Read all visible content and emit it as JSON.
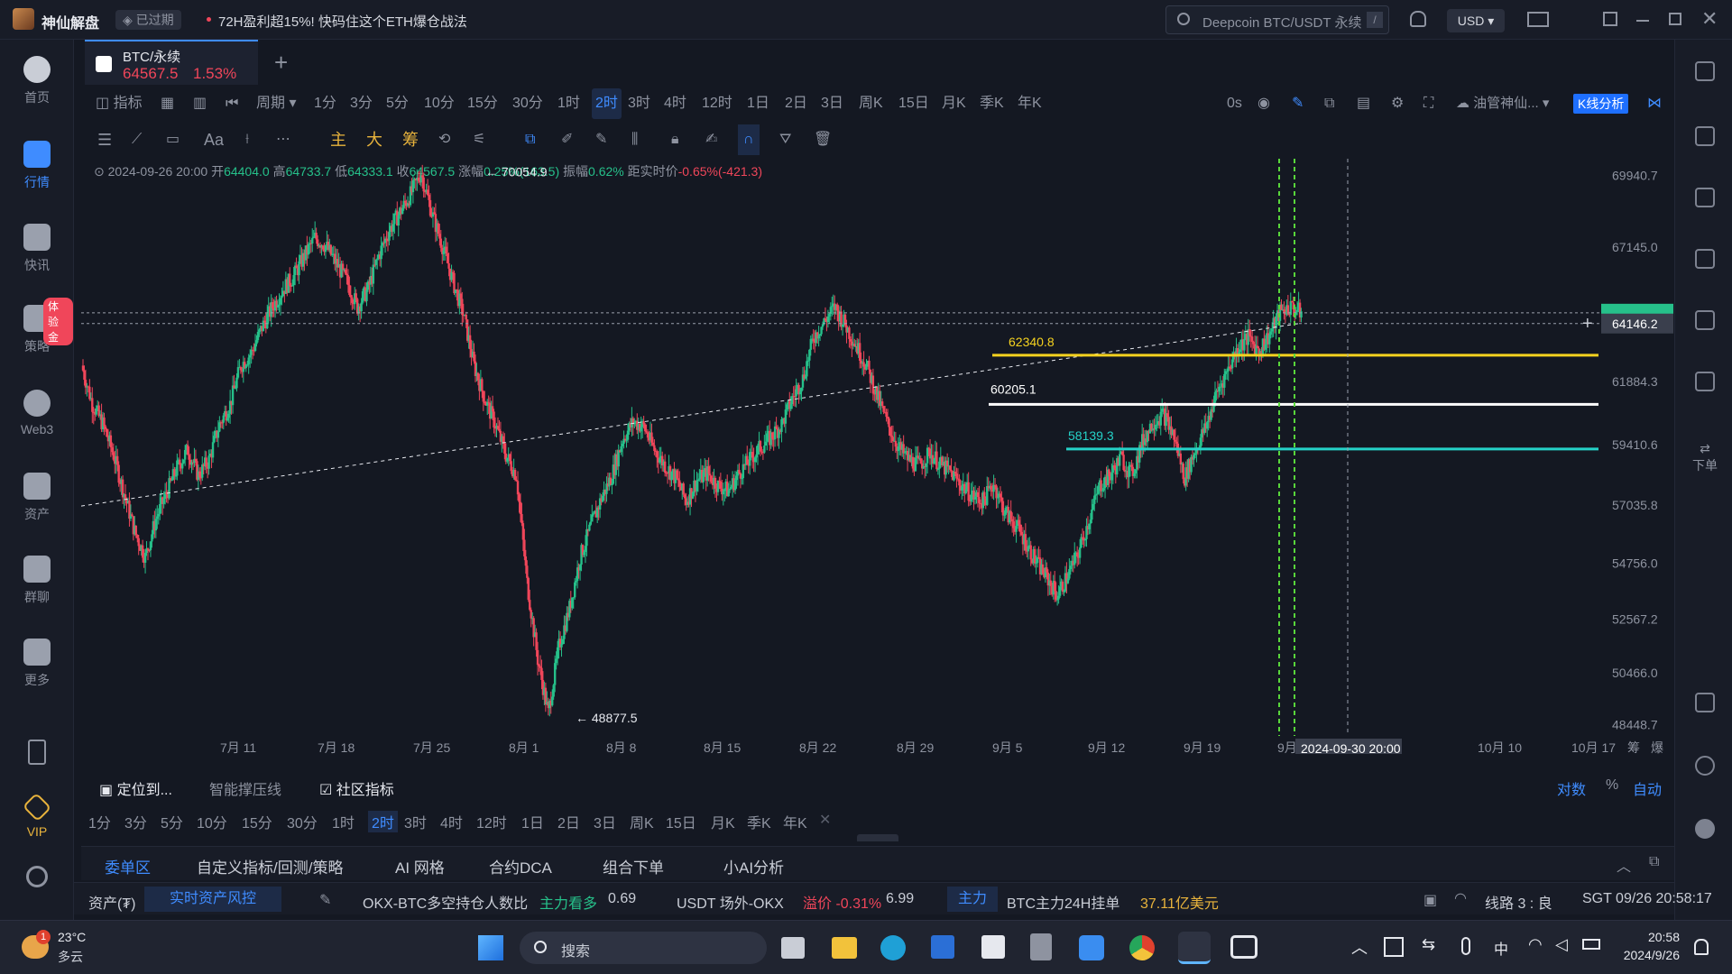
{
  "app": {
    "name": "神仙解盘",
    "expired_label": "已过期",
    "promo": "72H盈利超15%! 快码住这个ETH爆仓战法",
    "search_placeholder": "Deepcoin BTC/USDT 永续",
    "search_shortcut": "/",
    "currency": "USD"
  },
  "sidebar": [
    {
      "label": "首页"
    },
    {
      "label": "行情"
    },
    {
      "label": "快讯"
    },
    {
      "label": "策略",
      "badge": "体验金"
    },
    {
      "label": "Web3"
    },
    {
      "label": "资产"
    },
    {
      "label": "群聊"
    },
    {
      "label": "更多"
    },
    {
      "label": "VIP"
    }
  ],
  "symbol_tab": {
    "name": "BTC/永续",
    "price": "64567.5",
    "change": "1.53%"
  },
  "toolbar1": {
    "indicator_label": "指标",
    "period_label": "周期",
    "timeframes": [
      "1分",
      "3分",
      "5分",
      "10分",
      "15分",
      "30分",
      "1时",
      "2时",
      "3时",
      "4时",
      "12时",
      "1日",
      "2日",
      "3日",
      "周K",
      "15日",
      "月K",
      "季K",
      "年K"
    ],
    "active_timeframe": "2时",
    "countdown": "0s",
    "user": "油管神仙...",
    "kline_btn": "K线分析"
  },
  "toolbar2": {
    "main": "主",
    "big": "大",
    "chip": "筹"
  },
  "ohlc": {
    "date": "2024-09-26 20:00",
    "open_label": "开",
    "open": "64404.0",
    "high_label": "高",
    "high": "64733.7",
    "low_label": "低",
    "low": "64333.1",
    "close_label": "收",
    "close": "64567.5",
    "chg_label": "涨幅",
    "chg": "0.25%(163.5)",
    "amp_label": "振幅",
    "amp": "0.62%",
    "dist_label": "距实时价",
    "dist": "-0.65%(-421.3)"
  },
  "chart_data": {
    "type": "candlestick",
    "y_ticks": [
      "69940.7",
      "67145.0",
      "64146.2",
      "61884.3",
      "59410.6",
      "57035.8",
      "54756.0",
      "52567.2",
      "50466.0",
      "48448.7"
    ],
    "x_ticks": [
      "7月 11",
      "7月 18",
      "7月 25",
      "8月 1",
      "8月 8",
      "8月 15",
      "8月 22",
      "8月 29",
      "9月 5",
      "9月 12",
      "9月 19",
      "9月 2",
      "10月 10",
      "10月 17"
    ],
    "crosshair_time": "2024-09-30 20:00",
    "current_price_tag": "64146.2",
    "annotations": {
      "high": "70054.9",
      "low": "48877.5",
      "line_yellow": "62340.8",
      "line_white": "60205.1",
      "line_cyan": "58139.3"
    },
    "axis_labels": [
      "筹",
      "爆"
    ],
    "ylim": [
      48000,
      70600
    ],
    "close_path": [
      62500,
      61000,
      60200,
      59000,
      57500,
      56000,
      55000,
      56500,
      57500,
      58500,
      59200,
      58200,
      58800,
      60200,
      61000,
      62500,
      63000,
      64000,
      64800,
      65500,
      66000,
      66800,
      67500,
      67200,
      66500,
      65800,
      64800,
      65500,
      66800,
      67800,
      68500,
      69200,
      70054.9,
      68500,
      67200,
      65800,
      64500,
      62500,
      61200,
      60200,
      59000,
      58200,
      54000,
      51000,
      48877.5,
      51500,
      53000,
      55000,
      56200,
      57300,
      58200,
      59600,
      60300,
      60100,
      59200,
      58600,
      58100,
      57200,
      58000,
      58300,
      57800,
      57600,
      58300,
      58800,
      59300,
      59700,
      60200,
      61200,
      62000,
      63600,
      64200,
      64800,
      64100,
      63300,
      62500,
      61300,
      60200,
      59300,
      58800,
      58600,
      59100,
      58600,
      58300,
      57800,
      57400,
      57200,
      57900,
      56800,
      56300,
      55600,
      54800,
      54200,
      53500,
      54300,
      55200,
      56500,
      57800,
      58200,
      58900,
      58200,
      59500,
      60300,
      60600,
      59700,
      58100,
      59200,
      60100,
      61400,
      62300,
      63200,
      63600,
      63100,
      63700,
      64600,
      64800,
      64567.5
    ]
  },
  "bottombar1": {
    "locate": "定位到...",
    "support": "智能撑压线",
    "community": "社区指标",
    "log": "对数",
    "pct": "%",
    "auto": "自动"
  },
  "bottombar2": {
    "timeframes": [
      "1分",
      "3分",
      "5分",
      "10分",
      "15分",
      "30分",
      "1时",
      "2时",
      "3时",
      "4时",
      "12时",
      "1日",
      "2日",
      "3日",
      "周K",
      "15日",
      "月K",
      "季K",
      "年K"
    ],
    "active": "2时"
  },
  "bottom_tabs": [
    "委单区",
    "自定义指标/回测/策略",
    "AI 网格",
    "合约DCA",
    "组合下单",
    "小AI分析"
  ],
  "status": {
    "asset_label": "资产(₮)",
    "risk": "实时资产风控",
    "ls_label": "OKX-BTC多空持仓人数比",
    "ls_state": "主力看多",
    "ls_value": "0.69",
    "usdt_label": "USDT 场外-OKX",
    "premium": "溢价 -0.31%",
    "premium_value": "6.99",
    "main_tag": "主力",
    "order_label": "BTC主力24H挂单",
    "order_value": "37.11亿美元",
    "line": "线路 3 : 良",
    "time": "SGT 09/26 20:58:17"
  },
  "taskbar": {
    "temp": "23°C",
    "weather": "多云",
    "search": "搜索",
    "ime": "中",
    "clock_time": "20:58",
    "clock_date": "2024/9/26",
    "weather_badge": "1"
  },
  "colors": {
    "up": "#26c08a",
    "down": "#f0465a",
    "accent": "#3f8cff",
    "yellow": "#f5d21f",
    "cyan": "#25d2c8"
  }
}
